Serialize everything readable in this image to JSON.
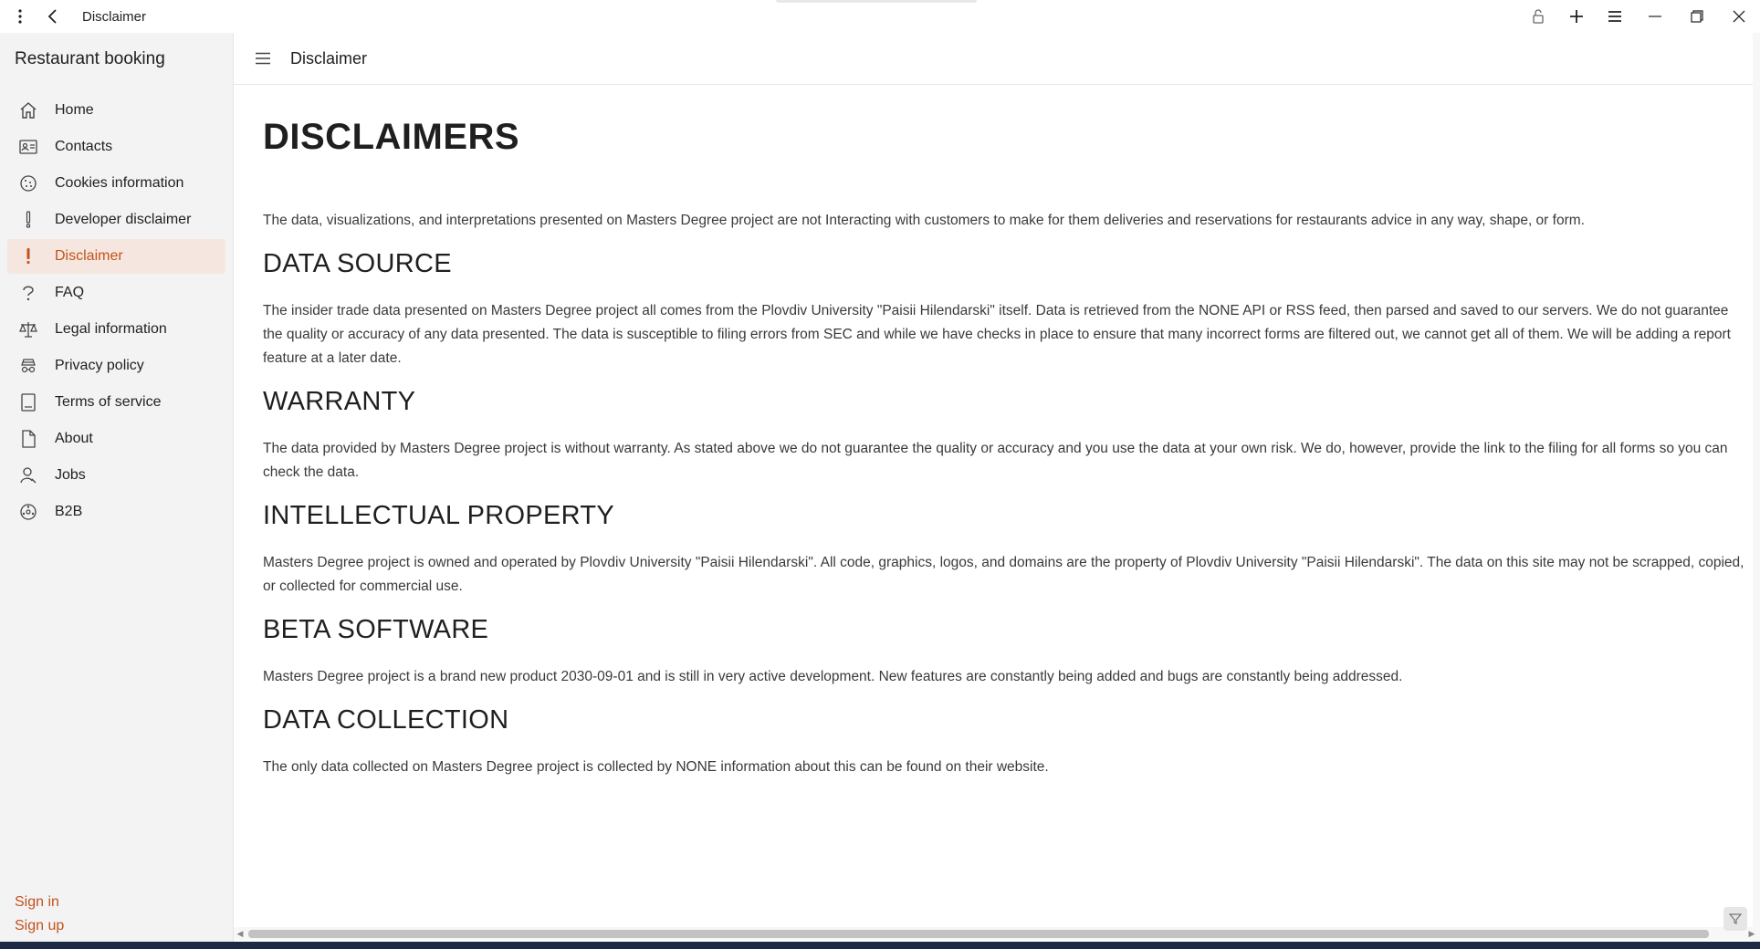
{
  "window": {
    "title": "Disclaimer"
  },
  "sidebar": {
    "app_title": "Restaurant booking",
    "items": [
      {
        "label": "Home",
        "icon": "home-icon"
      },
      {
        "label": "Contacts",
        "icon": "contact-card-icon"
      },
      {
        "label": "Cookies information",
        "icon": "cookie-icon"
      },
      {
        "label": "Developer disclaimer",
        "icon": "exclamation-icon"
      },
      {
        "label": "Disclaimer",
        "icon": "exclamation-icon",
        "active": true
      },
      {
        "label": "FAQ",
        "icon": "question-icon"
      },
      {
        "label": "Legal information",
        "icon": "scales-icon"
      },
      {
        "label": "Privacy policy",
        "icon": "privacy-icon"
      },
      {
        "label": "Terms of service",
        "icon": "document-icon"
      },
      {
        "label": "About",
        "icon": "page-icon"
      },
      {
        "label": "Jobs",
        "icon": "person-icon"
      },
      {
        "label": "B2B",
        "icon": "network-icon"
      }
    ],
    "sign_in": "Sign in",
    "sign_up": "Sign up"
  },
  "header": {
    "title": "Disclaimer"
  },
  "content": {
    "heading": "DISCLAIMERS",
    "intro": "The data, visualizations, and interpretations presented on Masters Degree project are not Interacting with customers to make for them deliveries and reservations for restaurants advice in any way, shape, or form.",
    "sections": [
      {
        "title": "DATA SOURCE",
        "text": "The insider trade data presented on Masters Degree project all comes from the Plovdiv University \"Paisii Hilendarski\" itself. Data is retrieved from the NONE API or RSS feed, then parsed and saved to our servers. We do not guarantee the quality or accuracy of any data presented. The data is susceptible to filing errors from SEC and while we have checks in place to ensure that many incorrect forms are filtered out, we cannot get all of them. We will be adding a report feature at a later date."
      },
      {
        "title": "WARRANTY",
        "text": "The data provided by Masters Degree project is without warranty. As stated above we do not guarantee the quality or accuracy and you use the data at your own risk. We do, however, provide the link to the filing for all forms so you can check the data."
      },
      {
        "title": "INTELLECTUAL PROPERTY",
        "text": "Masters Degree project is owned and operated by Plovdiv University \"Paisii Hilendarski\". All code, graphics, logos, and domains are the property of Plovdiv University \"Paisii Hilendarski\". The data on this site may not be scrapped, copied, or collected for commercial use."
      },
      {
        "title": "BETA SOFTWARE",
        "text": "Masters Degree project is a brand new product 2030-09-01 and is still in very active development. New features are constantly being added and bugs are constantly being addressed."
      },
      {
        "title": "DATA COLLECTION",
        "text": "The only data collected on Masters Degree project is collected by NONE information about this can be found on their website."
      }
    ]
  },
  "colors": {
    "accent": "#c4521c",
    "active_bg": "#f5e6df",
    "sidebar_bg": "#f3f3f3"
  }
}
